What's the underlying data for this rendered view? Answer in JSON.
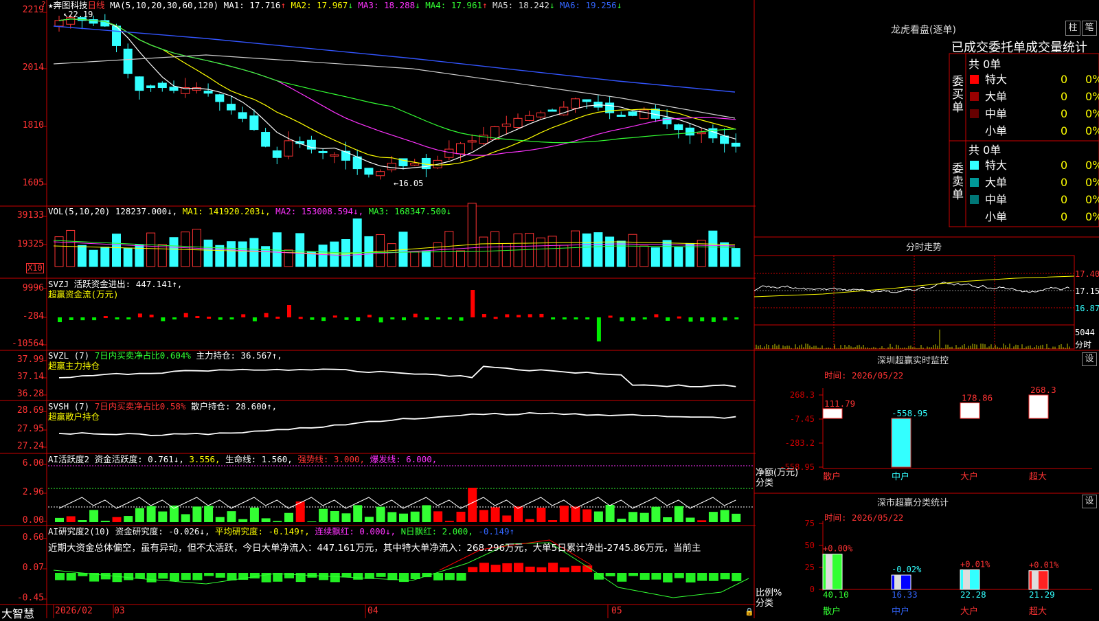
{
  "main_chart": {
    "star": "★",
    "stock_name": "奔图科技",
    "period": "日线",
    "ma_formula": "MA(5,10,20,30,60,120)",
    "ma": [
      {
        "label": "MA1:",
        "value": "17.716",
        "arrow": "↑",
        "color": "#ffffff"
      },
      {
        "label": "MA2:",
        "value": "17.967",
        "arrow": "↓",
        "color": "#ffff00"
      },
      {
        "label": "MA3:",
        "value": "18.288",
        "arrow": "↓",
        "color": "#ff33ff"
      },
      {
        "label": "MA4:",
        "value": "17.961",
        "arrow": "↑",
        "color": "#33ff33"
      },
      {
        "label": "MA5:",
        "value": "18.242",
        "arrow": "↓",
        "color": "#dddddd"
      },
      {
        "label": "MA6:",
        "value": "19.256",
        "arrow": "↓",
        "color": "#3366ff"
      }
    ],
    "y_ticks": [
      "2219",
      "2014",
      "1810",
      "1605"
    ],
    "high_mark": "22.19",
    "low_mark": "←16.05",
    "question": "?"
  },
  "vol_panel": {
    "name": "VOL(5,10,20)",
    "value": "128237.000↓,",
    "ma1": "MA1: 141920.203↓,",
    "ma2": "MA2: 153008.594↓,",
    "ma3": "MA3: 168347.500↓",
    "y_ticks": [
      "39133",
      "19325"
    ],
    "unit": "X10"
  },
  "svzj_panel": {
    "name": "SVZJ",
    "label": "活跃资金进出:",
    "value": "447.141↑,",
    "subtitle": "超赢资金流(万元)",
    "y_ticks": [
      "9996",
      "-284",
      "-10564"
    ]
  },
  "svzl_panel": {
    "name": "SVZL (7)",
    "label": "7日内买卖净占比0.604%",
    "hold": "主力持仓: 36.567↑,",
    "subtitle": "超赢主力持仓",
    "y_ticks": [
      "37.99",
      "37.14",
      "36.28"
    ]
  },
  "svsh_panel": {
    "name": "SVSH (7)",
    "label": "7日内买卖净占比0.58%",
    "hold": "散户持仓: 28.600↑,",
    "subtitle": "超赢散户持仓",
    "y_ticks": [
      "28.69",
      "27.95",
      "27.24"
    ]
  },
  "ai_active_panel": {
    "name": "AI活跃度2",
    "label": "资金活跃度: 0.761↓,",
    "v2": "3.556,",
    "life": "生命线: 1.560,",
    "strong": "强势线: 3.000,",
    "burst": "爆发线: 6.000,",
    "y_ticks": [
      "6.00",
      "2.96",
      "0.00"
    ]
  },
  "ai_research_panel": {
    "name": "AI研究度2(10)",
    "label": "资金研究度: -0.026↓,",
    "avg": "平均研究度: -0.149↑,",
    "cont": "连续飘红: 0.000↓,",
    "nday": "N日飘红: 2.000,",
    "last": "-0.149↑",
    "text": "近期大资金总体偏空，虽有异动，但不太活跃，今日大单净流入：447.161万元，其中特大单净流入：268.296万元，大单5日累计净出-2745.86万元，当前主",
    "y_ticks": [
      "0.60",
      "0.07",
      "-0.45"
    ]
  },
  "bottom_bar": {
    "brand": "大智慧",
    "dates": [
      "2026/02",
      "03",
      "04",
      "05"
    ]
  },
  "lhb": {
    "title": "龙虎看盘(逐单)",
    "btn1": "柱",
    "btn2": "笔",
    "subtitle": "已成交委托单成交量统计",
    "buy_side": "委买单",
    "sell_side": "委卖单",
    "buy_total": "共 0单",
    "sell_total": "共 0单",
    "rows": [
      {
        "name": "特大",
        "v": "0",
        "p": "0%",
        "color": "#ff0000"
      },
      {
        "name": "大单",
        "v": "0",
        "p": "0%",
        "color": "#990000"
      },
      {
        "name": "中单",
        "v": "0",
        "p": "0%",
        "color": "#660000"
      },
      {
        "name": "小单",
        "v": "0",
        "p": "0%",
        "color": "#000000"
      }
    ],
    "sell_rows": [
      {
        "name": "特大",
        "v": "0",
        "p": "0%",
        "color": "#33ffff"
      },
      {
        "name": "大单",
        "v": "0",
        "p": "0%",
        "color": "#009999"
      },
      {
        "name": "中单",
        "v": "0",
        "p": "0%",
        "color": "#007777"
      },
      {
        "name": "小单",
        "v": "0",
        "p": "0%",
        "color": "#000000"
      }
    ]
  },
  "intraday": {
    "title": "分时走势",
    "prices": [
      "17.40",
      "17.15",
      "16.87"
    ],
    "vol": "5044",
    "unit": "分时"
  },
  "sz_monitor": {
    "title": "深圳超赢实时监控",
    "btn": "设",
    "time": "时间: 2026/05/22",
    "y_ticks": [
      "268.3",
      "-7.45",
      "-283.2",
      "-558.95"
    ],
    "y_title1": "净额(万元)",
    "y_title2": "分类",
    "bars": [
      {
        "cat": "散户",
        "value": 111.79,
        "label": "111.79"
      },
      {
        "cat": "中户",
        "value": -558.95,
        "label": "-558.95"
      },
      {
        "cat": "大户",
        "value": 178.86,
        "label": "178.86"
      },
      {
        "cat": "超大",
        "value": 268.3,
        "label": "268.3"
      }
    ]
  },
  "sz_class": {
    "title": "深市超赢分类统计",
    "btn": "设",
    "time": "时间: 2026/05/22",
    "y_ticks": [
      "75",
      "50",
      "25",
      "0"
    ],
    "y_title1": "比例%",
    "y_title2": "分类",
    "bars": [
      {
        "cat": "散户",
        "value": 40.1,
        "label": "40.10",
        "chg": "+0.00%"
      },
      {
        "cat": "中户",
        "value": 16.33,
        "label": "16.33",
        "chg": "-0.02%"
      },
      {
        "cat": "大户",
        "value": 22.28,
        "label": "22.28",
        "chg": "+0.01%"
      },
      {
        "cat": "超大",
        "value": 21.29,
        "label": "21.29",
        "chg": "+0.01%"
      }
    ]
  },
  "colors": {
    "up": "#ff3333",
    "down": "#33ffff",
    "grid": "#cc0000"
  }
}
